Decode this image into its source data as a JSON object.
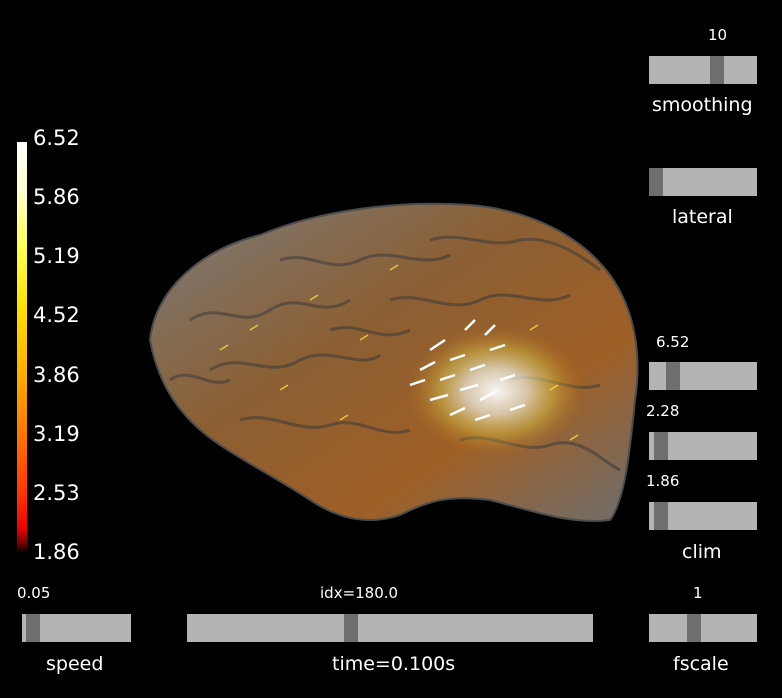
{
  "colorbar": {
    "ticks": [
      "6.52",
      "5.86",
      "5.19",
      "4.52",
      "3.86",
      "3.19",
      "2.53",
      "1.86"
    ]
  },
  "sliders": {
    "smoothing": {
      "value": "10",
      "label": "smoothing",
      "level": 0.65
    },
    "orientation": {
      "label": "lateral",
      "level": 0.0
    },
    "clim_max": {
      "value": "6.52",
      "level": 0.18
    },
    "clim_mid": {
      "value": "2.28",
      "level": 0.05
    },
    "clim_min": {
      "value": "1.86",
      "level": 0.05
    },
    "clim": {
      "label": "clim"
    },
    "speed": {
      "value": "0.05",
      "label": "speed",
      "level": 0.04
    },
    "time": {
      "value": "idx=180.0",
      "label": "time=0.100s",
      "level": 0.4
    },
    "fscale": {
      "value": "1",
      "label": "fscale",
      "level": 0.4
    }
  }
}
